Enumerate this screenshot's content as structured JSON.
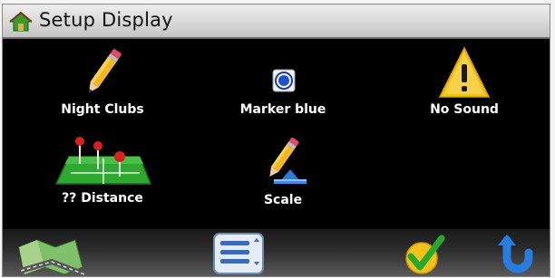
{
  "window": {
    "title": "Setup Display",
    "title_icon": "house-icon"
  },
  "grid": {
    "items": [
      {
        "label": "Night Clubs",
        "icon": "pencil-icon"
      },
      {
        "label": "Marker blue",
        "icon": "radio-marker-icon"
      },
      {
        "label": "No Sound",
        "icon": "warning-icon"
      },
      {
        "label": "?? Distance",
        "icon": "map-pins-icon"
      },
      {
        "label": "Scale",
        "icon": "pencil-scale-icon"
      }
    ]
  },
  "toolbar": {
    "buttons": [
      {
        "icon": "map-icon"
      },
      {
        "icon": "list-icon"
      },
      {
        "icon": "checkmark-icon"
      },
      {
        "icon": "back-arrow-icon"
      }
    ]
  },
  "colors": {
    "title_bar": "#d8d8d8",
    "screen_background": "#000000",
    "label_text": "#ffffff",
    "accent_blue": "#1e4fd6"
  }
}
